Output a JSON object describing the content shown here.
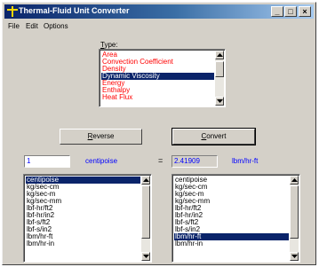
{
  "window": {
    "title": "Thermal-Fluid Unit Converter"
  },
  "menu": [
    "File",
    "Edit",
    "Options"
  ],
  "type_section": {
    "label_prefix": "",
    "label_hotkey": "T",
    "label_rest": "ype:",
    "items": [
      "Area",
      "Convection Coefficient",
      "Density",
      "Dynamic Viscosity",
      "Energy",
      "Enthalpy",
      "Heat Flux"
    ],
    "selected": "Dynamic Viscosity"
  },
  "buttons": {
    "reverse_hotkey": "R",
    "reverse_rest": "everse",
    "convert_hotkey": "C",
    "convert_rest": "onvert"
  },
  "conversion": {
    "input_value": "1",
    "from_unit": "centipoise",
    "equals": "=",
    "result_value": "2.41909",
    "to_unit": "lbm/hr-ft"
  },
  "from_units": {
    "items": [
      "centipoise",
      "kg/sec-cm",
      "kg/sec-m",
      "kg/sec-mm",
      "lbf-hr/ft2",
      "lbf-hr/in2",
      "lbf-s/ft2",
      "lbf-s/in2",
      "lbm/hr-ft",
      "lbm/hr-in"
    ],
    "selected": "centipoise"
  },
  "to_units": {
    "items": [
      "centipoise",
      "kg/sec-cm",
      "kg/sec-m",
      "kg/sec-mm",
      "lbf-hr/ft2",
      "lbf-hr/in2",
      "lbf-s/ft2",
      "lbf-s/in2",
      "lbm/hr-ft",
      "lbm/hr-in"
    ],
    "selected": "lbm/hr-ft"
  }
}
